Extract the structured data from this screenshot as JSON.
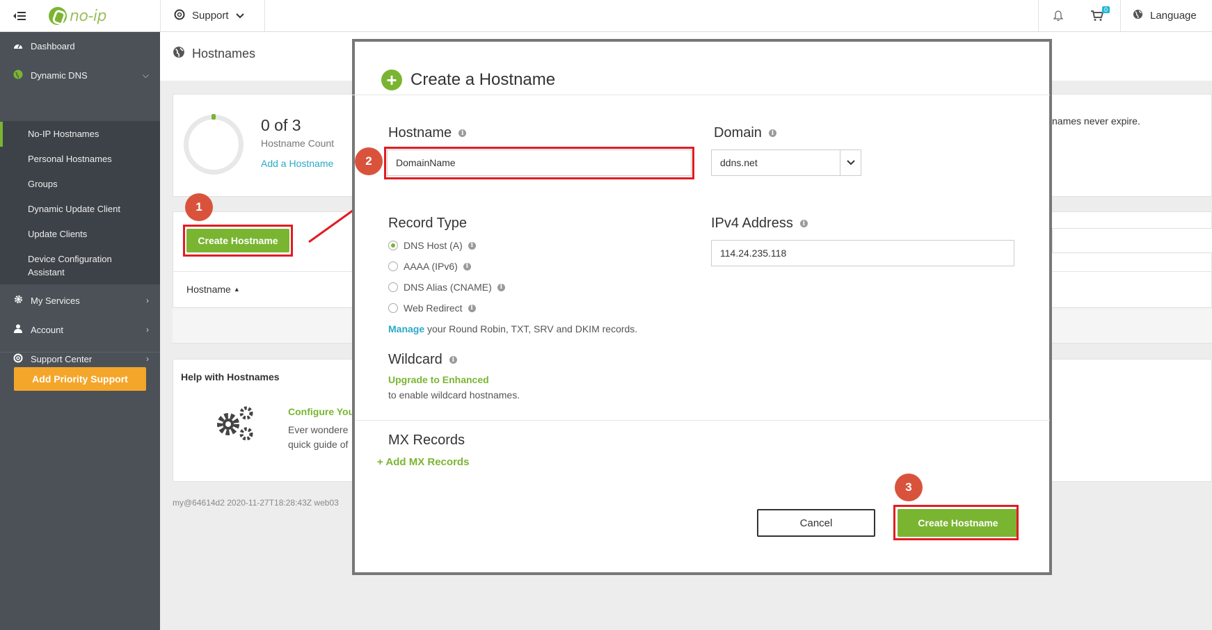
{
  "topbar": {
    "logo_text": "no-ip",
    "support_label": "Support",
    "cart_count": "0",
    "language_label": "Language"
  },
  "sidebar": {
    "items": [
      {
        "label": "Dashboard",
        "icon": "dashboard-icon"
      },
      {
        "label": "Dynamic DNS",
        "icon": "globe-icon"
      },
      {
        "label": "My Services",
        "icon": "gear-icon"
      },
      {
        "label": "Account",
        "icon": "user-icon"
      },
      {
        "label": "Support Center",
        "icon": "lifebuoy-icon"
      }
    ],
    "subitems": [
      "No-IP Hostnames",
      "Personal Hostnames",
      "Groups",
      "Dynamic Update Client",
      "Update Clients",
      "Device Configuration Assistant"
    ],
    "priority_button": "Add Priority Support"
  },
  "page": {
    "title": "Hostnames",
    "count": "0 of 3",
    "count_label": "Hostname Count",
    "add_link": "Add a Hostname",
    "create_button": "Create Hostname",
    "table_header": "Hostname",
    "behind_text_1": "names never expire.",
    "help_title": "Help with Hostnames",
    "help_link": "Configure You",
    "help_text": "Ever wondere quick guide of",
    "footer": "my@64614d2 2020-11-27T18:28:43Z web03"
  },
  "modal": {
    "title": "Create a Hostname",
    "hostname_label": "Hostname",
    "hostname_value": "DomainName",
    "domain_label": "Domain",
    "domain_value": "ddns.net",
    "record_type_label": "Record Type",
    "record_types": [
      "DNS Host (A)",
      "AAAA (IPv6)",
      "DNS Alias (CNAME)",
      "Web Redirect"
    ],
    "selected_record_type": "DNS Host (A)",
    "manage_link": "Manage",
    "manage_text": " your Round Robin, TXT, SRV and DKIM records.",
    "ipv4_label": "IPv4 Address",
    "ipv4_value": "114.24.235.118",
    "wildcard_label": "Wildcard",
    "upgrade_link": "Upgrade to Enhanced",
    "wildcard_note": "to enable wildcard hostnames.",
    "mx_label": "MX Records",
    "add_mx": "Add MX Records",
    "cancel_button": "Cancel",
    "create_button": "Create Hostname"
  },
  "annotations": {
    "step1": "1",
    "step2": "2",
    "step3": "3",
    "highlight_color": "#e21b23",
    "marker_color": "#d9533c"
  },
  "colors": {
    "brand_green": "#7ab532",
    "link_blue": "#2ba9c8",
    "sidebar_bg": "#4b5157",
    "priority_orange": "#f4a62a"
  }
}
